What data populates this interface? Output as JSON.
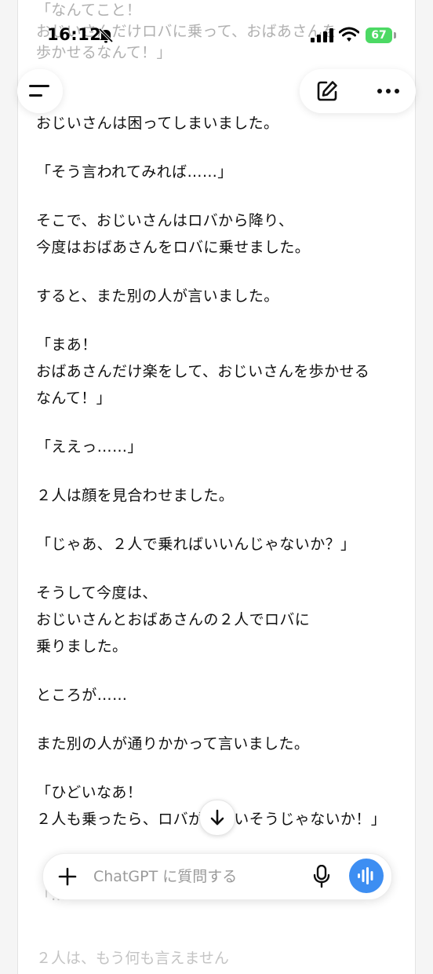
{
  "status_bar": {
    "time": "16:12",
    "battery": "67"
  },
  "faded_top_text": "「なんてこと！\nおじいさんだけロバに乗って、おばあさんを\n歩かせるなんて！」",
  "messages": [
    "おじいさんは困ってしまいました。",
    "「そう言われてみれば……」",
    "そこで、おじいさんはロバから降り、\n今度はおばあさんをロバに乗せました。",
    "すると、また別の人が言いました。",
    "「まあ！\nおばあさんだけ楽をして、おじいさんを歩かせる\nなんて！」",
    "「ええっ……」",
    "２人は顔を見合わせました。",
    "「じゃあ、２人で乗ればいいんじゃないか？」",
    "そうして今度は、\nおじいさんとおばあさんの２人でロバに\n乗りました。",
    "ところが……",
    "また別の人が通りかかって言いました。",
    "「ひどいなあ！\n２人も乗ったら、ロバがかわいそうじゃないか！」"
  ],
  "faded_bottom_text": "「……\n\n２人は、もう何も言えません",
  "composer": {
    "placeholder": "ChatGPT に質問する"
  },
  "icons": {
    "menu": "menu-icon",
    "edit": "new-chat-edit-icon",
    "more": "more-dots-icon",
    "scroll": "arrow-down-icon",
    "plus": "plus-icon",
    "mic": "microphone-icon",
    "voice": "voice-waveform-icon"
  },
  "colors": {
    "accent": "#3d8ef2",
    "battery": "#4cd964"
  }
}
